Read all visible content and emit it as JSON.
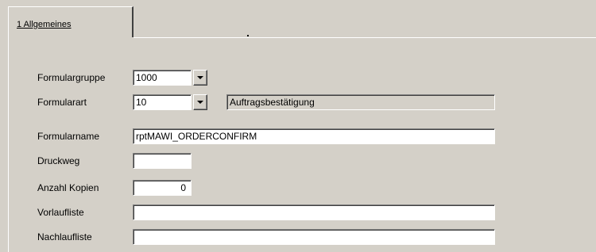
{
  "tabs": [
    {
      "label": "1 Allgemeines"
    }
  ],
  "form": {
    "formulargruppe": {
      "label": "Formulargruppe",
      "value": "1000"
    },
    "formularart": {
      "label": "Formularart",
      "value": "10",
      "description": "Auftragsbestätigung"
    },
    "formularname": {
      "label": "Formularname",
      "value": "rptMAWI_ORDERCONFIRM"
    },
    "druckweg": {
      "label": "Druckweg",
      "value": ""
    },
    "anzahl_kopien": {
      "label": "Anzahl Kopien",
      "value": "0"
    },
    "vorlaufliste": {
      "label": "Vorlaufliste",
      "value": ""
    },
    "nachlaufliste": {
      "label": "Nachlaufliste",
      "value": ""
    }
  },
  "icons": {
    "dropdown": "chevron-down-icon"
  }
}
